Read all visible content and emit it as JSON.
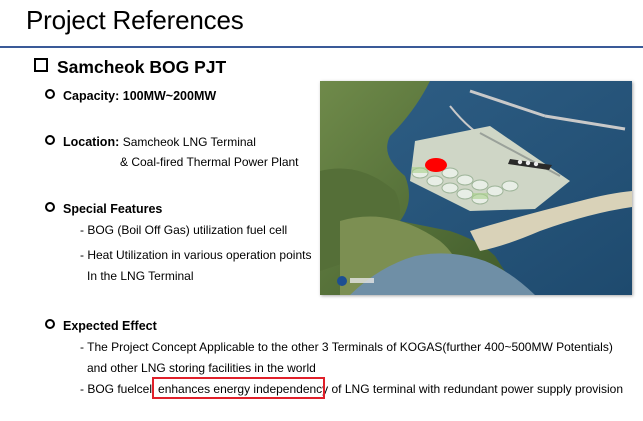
{
  "title": "Project References",
  "section": "Samcheok BOG PJT",
  "capacity": {
    "label": "Capacity: 100MW~200MW"
  },
  "location": {
    "label": "Location:",
    "line1": "Samcheok LNG Terminal",
    "line2": "& Coal-fired Thermal Power Plant"
  },
  "special": {
    "label": "Special Features",
    "line1": "- BOG (Boil Off Gas) utilization fuel cell",
    "line2": "- Heat Utilization in various operation points",
    "line3": "In the LNG Terminal"
  },
  "expected": {
    "label": "Expected Effect",
    "line1": "- The Project Concept Applicable to the other 3 Terminals of KOGAS(further 400~500MW Potentials)",
    "line2": "and other LNG storing facilities in the world",
    "line3_pre": "- BOG fuelcell ",
    "line3_hl": "enhances energy independency",
    "line3_post": " of LNG terminal with redundant power supply provision"
  },
  "colors": {
    "rule": "#3a5a98",
    "highlight_box": "#e0202a",
    "marker": "#ff0000"
  }
}
